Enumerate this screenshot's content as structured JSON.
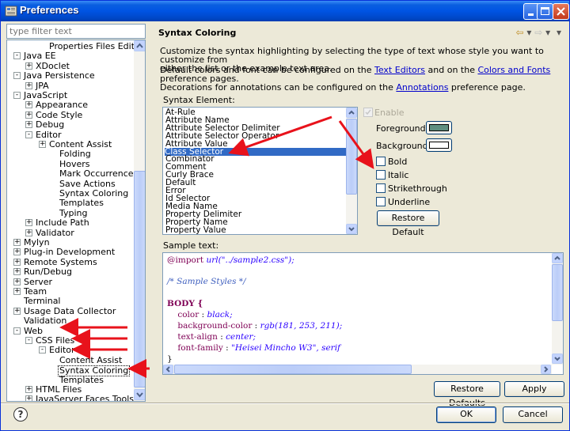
{
  "window": {
    "title": "Preferences",
    "controls": [
      "minimize-icon",
      "maximize-icon",
      "close-icon"
    ]
  },
  "filter": {
    "placeholder": "type filter text"
  },
  "tree": [
    {
      "label": "Properties Files Editor",
      "indent": 2,
      "toggle": ""
    },
    {
      "label": "Java EE",
      "indent": 0,
      "toggle": "-"
    },
    {
      "label": "XDoclet",
      "indent": 1,
      "toggle": "+"
    },
    {
      "label": "Java Persistence",
      "indent": 0,
      "toggle": "-"
    },
    {
      "label": "JPA",
      "indent": 1,
      "toggle": "+"
    },
    {
      "label": "JavaScript",
      "indent": 0,
      "toggle": "-"
    },
    {
      "label": "Appearance",
      "indent": 1,
      "toggle": "+"
    },
    {
      "label": "Code Style",
      "indent": 1,
      "toggle": "+"
    },
    {
      "label": "Debug",
      "indent": 1,
      "toggle": "+"
    },
    {
      "label": "Editor",
      "indent": 1,
      "toggle": "-"
    },
    {
      "label": "Content Assist",
      "indent": 2,
      "toggle": "+"
    },
    {
      "label": "Folding",
      "indent": 3,
      "toggle": ""
    },
    {
      "label": "Hovers",
      "indent": 3,
      "toggle": ""
    },
    {
      "label": "Mark Occurrences",
      "indent": 3,
      "toggle": ""
    },
    {
      "label": "Save Actions",
      "indent": 3,
      "toggle": ""
    },
    {
      "label": "Syntax Coloring",
      "indent": 3,
      "toggle": ""
    },
    {
      "label": "Templates",
      "indent": 3,
      "toggle": ""
    },
    {
      "label": "Typing",
      "indent": 3,
      "toggle": ""
    },
    {
      "label": "Include Path",
      "indent": 1,
      "toggle": "+"
    },
    {
      "label": "Validator",
      "indent": 1,
      "toggle": "+"
    },
    {
      "label": "Mylyn",
      "indent": 0,
      "toggle": "+"
    },
    {
      "label": "Plug-in Development",
      "indent": 0,
      "toggle": "+"
    },
    {
      "label": "Remote Systems",
      "indent": 0,
      "toggle": "+"
    },
    {
      "label": "Run/Debug",
      "indent": 0,
      "toggle": "+"
    },
    {
      "label": "Server",
      "indent": 0,
      "toggle": "+"
    },
    {
      "label": "Team",
      "indent": 0,
      "toggle": "+"
    },
    {
      "label": "Terminal",
      "indent": 0,
      "toggle": ""
    },
    {
      "label": "Usage Data Collector",
      "indent": 0,
      "toggle": "+"
    },
    {
      "label": "Validation",
      "indent": 0,
      "toggle": ""
    },
    {
      "label": "Web",
      "indent": 0,
      "toggle": "-"
    },
    {
      "label": "CSS Files",
      "indent": 1,
      "toggle": "-"
    },
    {
      "label": "Editor",
      "indent": 2,
      "toggle": "-"
    },
    {
      "label": "Content Assist",
      "indent": 3,
      "toggle": ""
    },
    {
      "label": "Syntax Coloring",
      "indent": 3,
      "toggle": "",
      "selected": true
    },
    {
      "label": "Templates",
      "indent": 3,
      "toggle": ""
    },
    {
      "label": "HTML Files",
      "indent": 1,
      "toggle": "+"
    },
    {
      "label": "JavaServer Faces Tools",
      "indent": 1,
      "toggle": "+"
    }
  ],
  "page": {
    "title": "Syntax Coloring",
    "nav_back": "⇦",
    "nav_forward": "⇨",
    "nav_dropdown": "▾",
    "desc1_line1": "Customize the syntax highlighting by selecting the type of text whose style you want to customize from",
    "desc1_line2": "either the list or the example text area.",
    "desc2_pre": "Default colors and font can be configured on the ",
    "desc2_link1": "Text Editors",
    "desc2_mid": " and on the ",
    "desc2_link2": "Colors and Fonts",
    "desc2_post": " preference pages.",
    "desc3_pre": "Decorations for annotations can be configured on the ",
    "desc3_link": "Annotations",
    "desc3_post": " preference page."
  },
  "syntax": {
    "label": "Syntax Element:",
    "items": [
      "At-Rule",
      "Attribute Name",
      "Attribute Selector Delimiter",
      "Attribute Selector Operator",
      "Attribute Value",
      "Class Selector",
      "Combinator",
      "Comment",
      "Curly Brace",
      "Default",
      "Error",
      "Id Selector",
      "Media Name",
      "Property Delimiter",
      "Property Name",
      "Property Value"
    ],
    "selected_index": 5
  },
  "options": {
    "enable": "Enable",
    "foreground": "Foreground:",
    "background": "Background:",
    "bold": "Bold",
    "italic": "Italic",
    "strikethrough": "Strikethrough",
    "underline": "Underline",
    "restore_default": "Restore Default",
    "foreground_color": "#5f8f80",
    "background_color": "#ffffff"
  },
  "sample": {
    "label": "Sample text:",
    "l1_kw": "@import",
    "l1_fn": " url(\"../sample2.css\");",
    "l2": "/* Sample Styles */",
    "l3": "BODY {",
    "l4_prop": "    color",
    "l4_colon": " : ",
    "l4_val": "black;",
    "l5_prop": "    background-color",
    "l5_colon": " : ",
    "l5_val": "rgb(181, 253, 211);",
    "l6_prop": "    text-align",
    "l6_colon": " : ",
    "l6_val": "center;",
    "l7_prop": "    font-family",
    "l7_colon": " : ",
    "l7_val": "\"Heisei Mincho W3\", serif",
    "l8": "}"
  },
  "buttons": {
    "restore_defaults": "Restore Defaults",
    "apply": "Apply",
    "ok": "OK",
    "cancel": "Cancel",
    "help": "?"
  },
  "colors": {
    "annotation_arrow": "#e8121b",
    "selection": "#316ac5",
    "link": "#0000cc"
  }
}
